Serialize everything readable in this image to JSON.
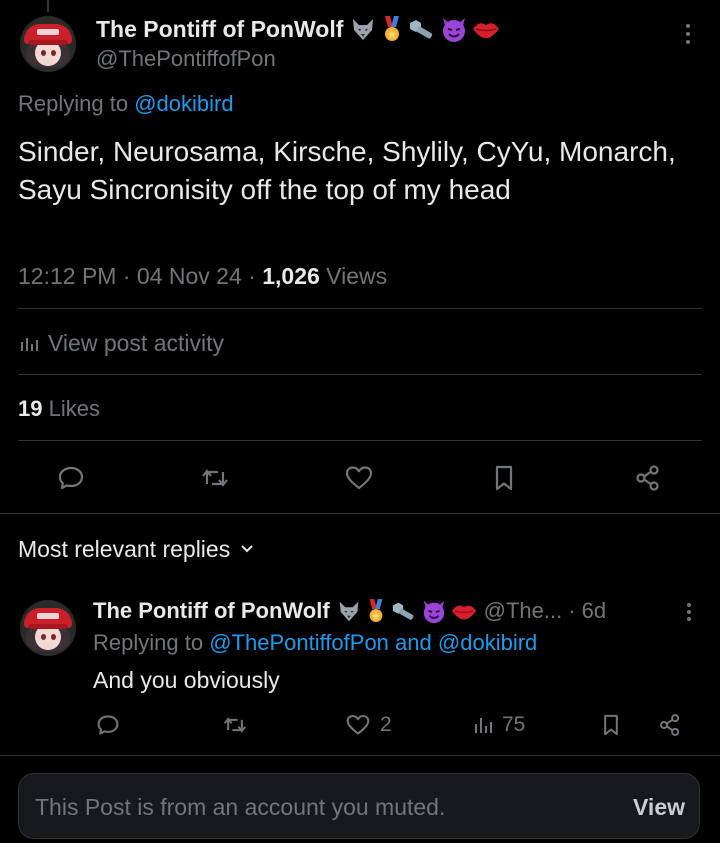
{
  "main_post": {
    "display_name": "The Pontiff of PonWolf",
    "handle": "@ThePontiffofPon",
    "emojis": [
      "wolf-emoji",
      "medal-emoji",
      "nut-bolt-emoji",
      "smiling-devil-emoji",
      "lips-emoji"
    ],
    "replying_label": "Replying to",
    "replying_to": "@dokibird",
    "body": "Sinder, Neurosama, Kirsche, Shylily, CyYu, Monarch, Sayu Sincronisity off the top of my head",
    "time": "12:12 PM",
    "date": "04 Nov 24",
    "views_count": "1,026",
    "views_label": "Views",
    "separator": "·",
    "activity_label": "View post activity",
    "likes_count": "19",
    "likes_label": "Likes"
  },
  "sort": {
    "label": "Most relevant replies"
  },
  "reply": {
    "display_name": "The Pontiff of PonWolf",
    "handle": "@The...",
    "age": "6d",
    "separator": "·",
    "replying_label": "Replying to",
    "replying_to_1": "@ThePontiffofPon",
    "and_label": "and",
    "replying_to_2": "@dokibird",
    "body": "And you obviously",
    "like_count": "2",
    "view_count": "75"
  },
  "muted": {
    "message": "This Post is from an account you muted.",
    "view_label": "View"
  },
  "colors": {
    "background": "#000000",
    "text": "#e7e9ea",
    "secondary": "#71767b",
    "accent": "#1d9bf0",
    "divider": "#2f3336"
  }
}
